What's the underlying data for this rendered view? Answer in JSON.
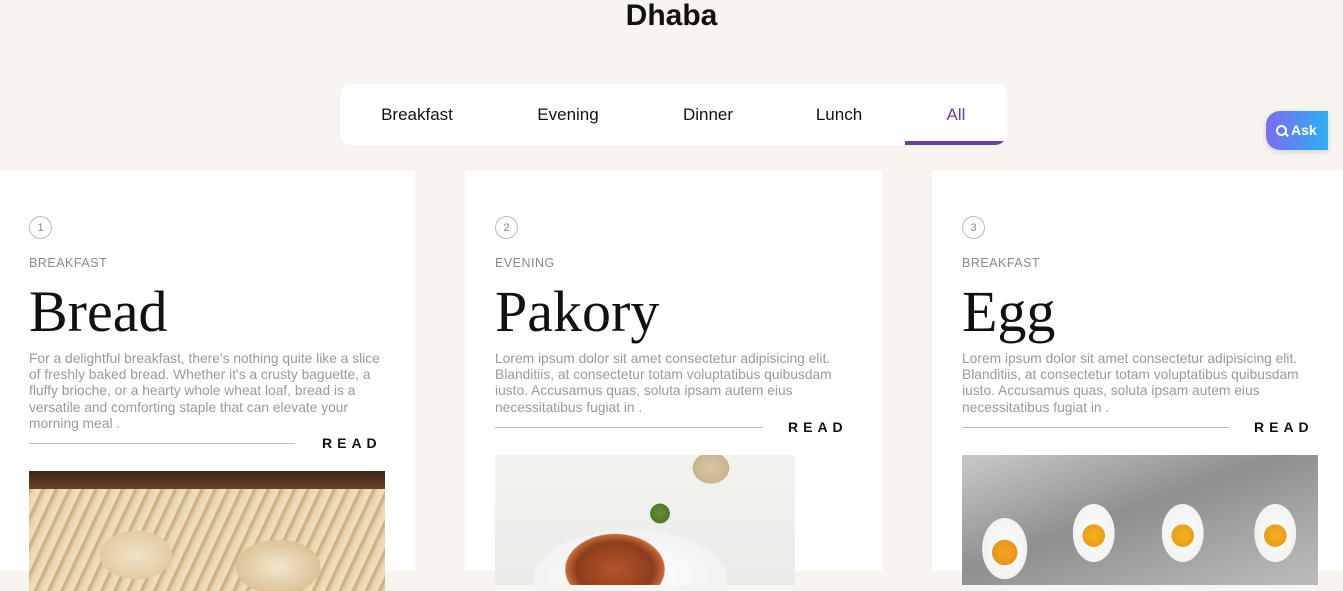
{
  "site": {
    "title": "Dhaba"
  },
  "tabs": [
    {
      "label": "Breakfast",
      "active": false
    },
    {
      "label": "Evening",
      "active": false
    },
    {
      "label": "Dinner",
      "active": false
    },
    {
      "label": "Lunch",
      "active": false
    },
    {
      "label": "All",
      "active": true
    }
  ],
  "ask_button": {
    "label": "Ask",
    "icon": "search-icon"
  },
  "colors": {
    "accent": "#6b3fa0",
    "background": "#f8f5f1"
  },
  "cards": [
    {
      "number": "1",
      "category": "BREAKFAST",
      "title": "Bread",
      "description": "For a delightful breakfast, there's nothing quite like a slice of freshly baked bread. Whether it's a crusty baguette, a fluffy brioche, or a hearty whole wheat loaf, bread is a versatile and comforting staple that can elevate your morning meal .",
      "read_label": "READ",
      "image": "bread-photo"
    },
    {
      "number": "2",
      "category": "EVENING",
      "title": "Pakory",
      "description": "Lorem ipsum dolor sit amet consectetur adipisicing elit. Blanditiis, at consectetur totam voluptatibus quibusdam iusto. Accusamus quas, soluta ipsam autem eius necessitatibus fugiat in .",
      "read_label": "READ",
      "image": "pakora-photo"
    },
    {
      "number": "3",
      "category": "BREAKFAST",
      "title": "Egg",
      "description": "Lorem ipsum dolor sit amet consectetur adipisicing elit. Blanditiis, at consectetur totam voluptatibus quibusdam iusto. Accusamus quas, soluta ipsam autem eius necessitatibus fugiat in .",
      "read_label": "READ",
      "image": "egg-photo"
    }
  ]
}
